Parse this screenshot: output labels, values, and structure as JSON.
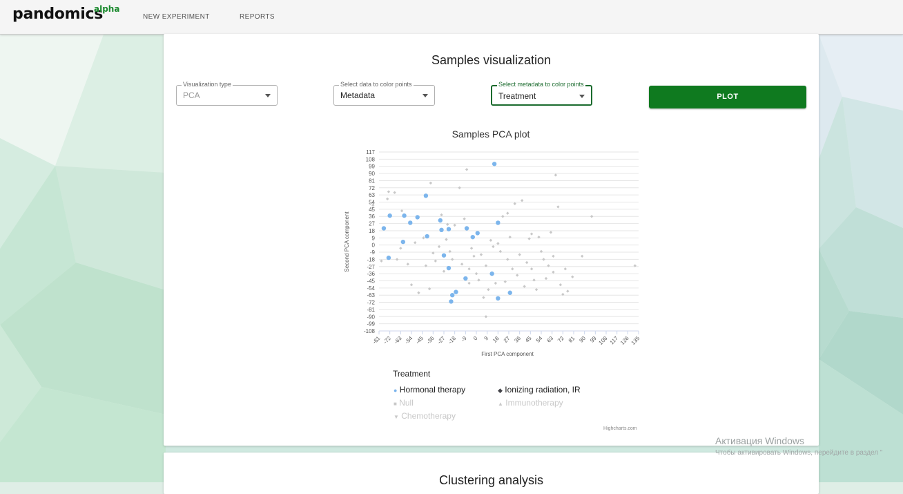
{
  "app": {
    "logo": "pandomics",
    "logo_sup": "alpha"
  },
  "nav": {
    "items": [
      "NEW EXPERIMENT",
      "REPORTS"
    ]
  },
  "samples": {
    "title": "Samples visualization",
    "visualization_type": {
      "label": "Visualization type",
      "value": "PCA"
    },
    "color_data": {
      "label": "Select data to color points",
      "value": "Metadata"
    },
    "color_metadata": {
      "label": "Select metadata to color points",
      "value": "Treatment"
    },
    "plot_button": "PLOT"
  },
  "chart_data": {
    "type": "scatter",
    "title": "Samples PCA plot",
    "xlabel": "First PCA component",
    "ylabel": "Second PCA component",
    "xlim": [
      -81,
      135
    ],
    "ylim": [
      -108,
      117
    ],
    "xticks": [
      -81,
      -72,
      -63,
      -54,
      -45,
      -36,
      -27,
      -18,
      -9,
      0,
      9,
      18,
      27,
      36,
      45,
      54,
      63,
      72,
      81,
      90,
      99,
      108,
      117,
      126,
      135
    ],
    "yticks": [
      117,
      108,
      99,
      90,
      81,
      72,
      63,
      54,
      45,
      36,
      27,
      18,
      9,
      0,
      -9,
      -18,
      -27,
      -36,
      -45,
      -54,
      -63,
      -72,
      -81,
      -90,
      -99,
      -108
    ],
    "grid": true,
    "legend_position": "bottom-left",
    "legend_title": "Treatment",
    "series": [
      {
        "name": "Hormonal therapy",
        "color": "#7cb5ec",
        "visible": true,
        "points": [
          [
            -73,
            -16
          ],
          [
            -77,
            21
          ],
          [
            -72,
            37
          ],
          [
            -61,
            4
          ],
          [
            -60,
            37
          ],
          [
            -55,
            28
          ],
          [
            -49,
            35
          ],
          [
            -42,
            62
          ],
          [
            -41,
            11
          ],
          [
            -30,
            31
          ],
          [
            -29,
            19
          ],
          [
            -27,
            -13
          ],
          [
            -23,
            -29
          ],
          [
            -23,
            20
          ],
          [
            -20,
            -63
          ],
          [
            -21,
            -71
          ],
          [
            -17,
            -59
          ],
          [
            -9,
            -42
          ],
          [
            -8,
            21
          ],
          [
            -3,
            10
          ],
          [
            1,
            15
          ],
          [
            13,
            -36
          ],
          [
            15,
            102
          ],
          [
            18,
            -67
          ],
          [
            18,
            28
          ],
          [
            28,
            -60
          ]
        ]
      },
      {
        "name": "Ionizing radiation, IR",
        "color": "#434348",
        "visible": false,
        "points": []
      },
      {
        "name": "Null",
        "color": "#c8c8c8",
        "visible": false,
        "points": [
          [
            -86,
            50
          ],
          [
            -79,
            -20
          ],
          [
            -74,
            58
          ],
          [
            -73,
            67
          ],
          [
            -68,
            66
          ],
          [
            -66,
            -18
          ],
          [
            -63,
            -4
          ],
          [
            -62,
            43
          ],
          [
            -57,
            -24
          ],
          [
            -54,
            -50
          ],
          [
            -51,
            3
          ],
          [
            -48,
            -60
          ],
          [
            -44,
            9
          ],
          [
            -42,
            -26
          ],
          [
            -39,
            -55
          ],
          [
            -36,
            -10
          ],
          [
            -34,
            -20
          ],
          [
            -31,
            -2
          ],
          [
            -29,
            38
          ],
          [
            -27,
            -33
          ],
          [
            -25,
            7
          ],
          [
            -22,
            -8
          ],
          [
            -20,
            -18
          ],
          [
            -18,
            25
          ],
          [
            -14,
            72
          ],
          [
            -12,
            -24
          ],
          [
            -10,
            33
          ],
          [
            -8,
            95
          ],
          [
            -6,
            -30
          ],
          [
            -4,
            -4
          ],
          [
            -2,
            -14
          ],
          [
            0,
            -36
          ],
          [
            2,
            -44
          ],
          [
            4,
            -12
          ],
          [
            6,
            -66
          ],
          [
            8,
            -26
          ],
          [
            10,
            -56
          ],
          [
            12,
            6
          ],
          [
            14,
            -2
          ],
          [
            16,
            -48
          ],
          [
            18,
            2
          ],
          [
            20,
            -8
          ],
          [
            22,
            36
          ],
          [
            24,
            -46
          ],
          [
            26,
            -18
          ],
          [
            28,
            10
          ],
          [
            30,
            -30
          ],
          [
            32,
            52
          ],
          [
            34,
            -38
          ],
          [
            36,
            -12
          ],
          [
            38,
            56
          ],
          [
            40,
            -52
          ],
          [
            42,
            -22
          ],
          [
            44,
            8
          ],
          [
            46,
            -30
          ],
          [
            48,
            -44
          ],
          [
            50,
            -56
          ],
          [
            52,
            10
          ],
          [
            54,
            -8
          ],
          [
            56,
            -18
          ],
          [
            58,
            -42
          ],
          [
            60,
            -26
          ],
          [
            62,
            16
          ],
          [
            64,
            -14
          ],
          [
            66,
            88
          ],
          [
            68,
            48
          ],
          [
            70,
            -50
          ],
          [
            72,
            -62
          ],
          [
            74,
            -30
          ],
          [
            76,
            -58
          ],
          [
            80,
            -40
          ],
          [
            88,
            -14
          ],
          [
            96,
            36
          ],
          [
            -38,
            78
          ],
          [
            -24,
            26
          ],
          [
            -6,
            -48
          ],
          [
            8,
            -90
          ],
          [
            26,
            40
          ],
          [
            46,
            14
          ],
          [
            132,
            -26
          ],
          [
            64,
            -34
          ]
        ]
      },
      {
        "name": "Immunotherapy",
        "color": "#e0e0e0",
        "visible": false,
        "points": []
      },
      {
        "name": "Chemotherapy",
        "color": "#e0e0e0",
        "visible": false,
        "points": []
      }
    ],
    "credits": "Highcharts.com"
  },
  "clustering": {
    "title": "Clustering analysis"
  },
  "watermark": {
    "line1": "Активация Windows",
    "line2": "Чтобы активировать Windows, перейдите в раздел \""
  }
}
